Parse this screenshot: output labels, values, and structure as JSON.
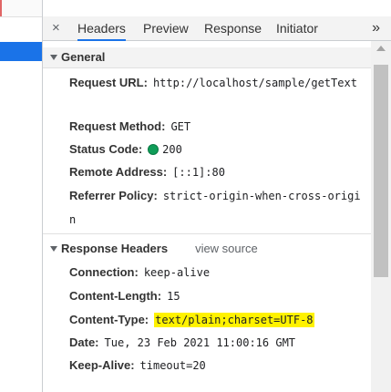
{
  "tabs": {
    "items": [
      {
        "label": "Headers",
        "active": true
      },
      {
        "label": "Preview",
        "active": false
      },
      {
        "label": "Response",
        "active": false
      },
      {
        "label": "Initiator",
        "active": false
      }
    ],
    "close_icon": "×",
    "more_icon": "»"
  },
  "general": {
    "title": "General",
    "request_url": {
      "key": "Request URL:",
      "value": "http://localhost/sample/getText"
    },
    "request_method": {
      "key": "Request Method:",
      "value": "GET"
    },
    "status_code": {
      "key": "Status Code:",
      "value": "200",
      "indicator_color": "#0f9d58"
    },
    "remote_address": {
      "key": "Remote Address:",
      "value": "[::1]:80"
    },
    "referrer_policy": {
      "key": "Referrer Policy:",
      "value": "strict-origin-when-cross-origin"
    }
  },
  "response_headers": {
    "title": "Response Headers",
    "view_source": "view source",
    "connection": {
      "key": "Connection:",
      "value": "keep-alive"
    },
    "content_length": {
      "key": "Content-Length:",
      "value": "15"
    },
    "content_type": {
      "key": "Content-Type:",
      "value": "text/plain;charset=UTF-8",
      "highlight_color": "#fff200"
    },
    "date": {
      "key": "Date:",
      "value": "Tue, 23 Feb 2021 11:00:16 GMT"
    },
    "keep_alive": {
      "key": "Keep-Alive:",
      "value": "timeout=20"
    }
  },
  "colors": {
    "accent": "#1a73e8",
    "highlight": "#fff200"
  }
}
